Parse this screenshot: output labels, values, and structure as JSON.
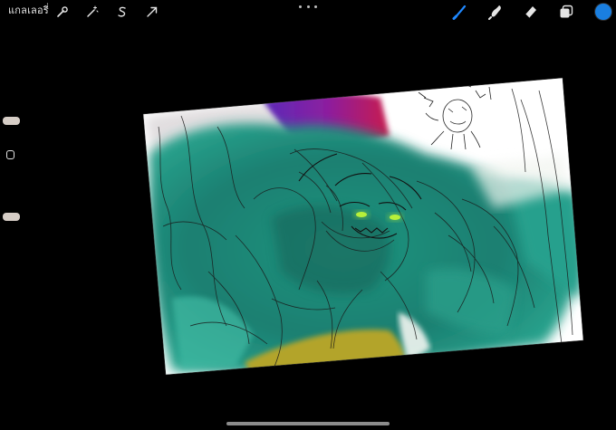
{
  "topbar": {
    "gallery_label": "แกลเลอรี่",
    "actions_icon": "wrench-icon",
    "adjustments_icon": "magic-wand-icon",
    "selection_icon": "selection-s-icon",
    "transform_icon": "arrow-cursor-icon",
    "more_icon": "more-dots-icon",
    "brush_icon": "brush-icon",
    "smudge_icon": "smudge-icon",
    "eraser_icon": "eraser-icon",
    "layers_icon": "layers-icon",
    "active_color": "#1a7fe0",
    "active_tool": "brush"
  },
  "sidebar": {
    "brush_size_icon": "slider-handle",
    "modify_icon": "square-modify-icon",
    "opacity_icon": "slider-handle"
  },
  "canvas": {
    "paper_color": "#ffffff",
    "paint_colors": [
      "#1f8f80",
      "#2aa391",
      "#167a6b",
      "#b5a52a",
      "#7a1f9e",
      "#c0185a"
    ],
    "eye_color": "#b7f03a"
  }
}
